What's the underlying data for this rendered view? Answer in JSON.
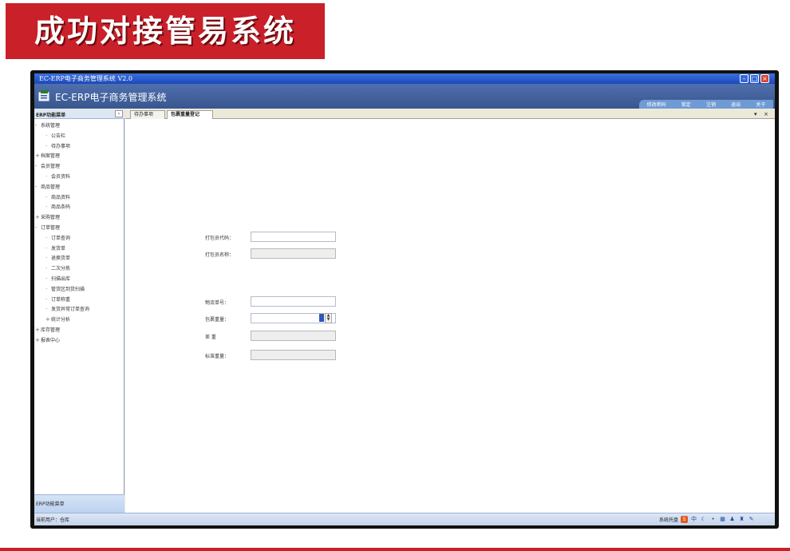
{
  "banner": {
    "title": "成功对接管易系统"
  },
  "window": {
    "title": "EC-ERP电子商务管理系统 V2.0",
    "controls": {
      "minimize": "–",
      "maximize": "□",
      "close": "×"
    }
  },
  "app": {
    "name": "EC-ERP电子商务管理系统",
    "top_nav": [
      "修改密码",
      "锁定",
      "注销",
      "退出",
      "关于"
    ]
  },
  "sidebar": {
    "title": "ERP功能菜单",
    "collapse_glyph": "‹",
    "footer": "ERP功能菜单",
    "items": [
      {
        "label": "系统管理",
        "level": 0,
        "marker": "-"
      },
      {
        "label": "公告栏",
        "level": 1
      },
      {
        "label": "待办事项",
        "level": 1
      },
      {
        "label": "档案管理",
        "level": 0,
        "marker": "+"
      },
      {
        "label": "会员管理",
        "level": 0,
        "marker": "-"
      },
      {
        "label": "会员资料",
        "level": 1
      },
      {
        "label": "商品管理",
        "level": 0,
        "marker": "-"
      },
      {
        "label": "商品资料",
        "level": 1
      },
      {
        "label": "商品条码",
        "level": 1
      },
      {
        "label": "采购管理",
        "level": 0,
        "marker": "+"
      },
      {
        "label": "订单管理",
        "level": 0,
        "marker": "-"
      },
      {
        "label": "订单查询",
        "level": 1
      },
      {
        "label": "发货单",
        "level": 1
      },
      {
        "label": "退换货单",
        "level": 1
      },
      {
        "label": "二次分拣",
        "level": 1
      },
      {
        "label": "扫描出库",
        "level": 1
      },
      {
        "label": "管货区到货扫描",
        "level": 1
      },
      {
        "label": "订单称重",
        "level": 1
      },
      {
        "label": "发货异常订单查询",
        "level": 1
      },
      {
        "label": "统计分析",
        "level": 1,
        "marker": "+"
      },
      {
        "label": "库存管理",
        "level": 0,
        "marker": "+"
      },
      {
        "label": "报表中心",
        "level": 0,
        "marker": "+"
      }
    ]
  },
  "tabs": {
    "items": [
      "待办事项",
      "包裹重量登记"
    ],
    "dropdown_glyph": "▾",
    "close_glyph": "×"
  },
  "form": {
    "fields": [
      {
        "label": "打包员代码：",
        "value": "",
        "readonly": false
      },
      {
        "label": "打包员名称：",
        "value": "",
        "readonly": true
      },
      {
        "label": "物流单号：",
        "value": "",
        "readonly": false
      },
      {
        "label": "包裹重量：",
        "value": "",
        "readonly": false
      },
      {
        "label": "差  重",
        "value": "",
        "readonly": true
      },
      {
        "label": "标准重量：",
        "value": "",
        "readonly": true
      }
    ],
    "spin_up": "▲",
    "spin_down": "▼"
  },
  "status": {
    "user": "当前用户：仓库",
    "tray_label": "系统托盘",
    "tray_icons": [
      {
        "name": "ime",
        "glyph": "S"
      },
      {
        "name": "lang",
        "glyph": "中"
      },
      {
        "name": "moon",
        "glyph": "☾"
      },
      {
        "name": "dot",
        "glyph": "•"
      },
      {
        "name": "keyboard",
        "glyph": "▦"
      },
      {
        "name": "person",
        "glyph": "♟"
      },
      {
        "name": "shirt",
        "glyph": "♜"
      },
      {
        "name": "wrench",
        "glyph": "✎"
      }
    ]
  }
}
